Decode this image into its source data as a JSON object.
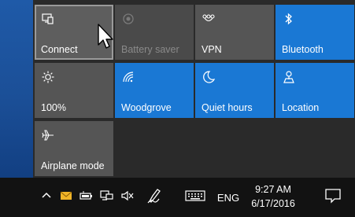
{
  "tiles": [
    {
      "id": "connect",
      "label": "Connect",
      "icon": "cast-icon",
      "state": "hover"
    },
    {
      "id": "battery-saver",
      "label": "Battery saver",
      "icon": "battery-saver-icon",
      "state": "disabled"
    },
    {
      "id": "vpn",
      "label": "VPN",
      "icon": "vpn-icon",
      "state": "off"
    },
    {
      "id": "bluetooth",
      "label": "Bluetooth",
      "icon": "bluetooth-icon",
      "state": "on"
    },
    {
      "id": "brightness",
      "label": "100%",
      "icon": "brightness-icon",
      "state": "off"
    },
    {
      "id": "wifi",
      "label": "Woodgrove",
      "icon": "wifi-icon",
      "state": "on"
    },
    {
      "id": "quiet-hours",
      "label": "Quiet hours",
      "icon": "moon-icon",
      "state": "on"
    },
    {
      "id": "location",
      "label": "Location",
      "icon": "location-icon",
      "state": "on"
    },
    {
      "id": "airplane-mode",
      "label": "Airplane mode",
      "icon": "airplane-icon",
      "state": "off"
    }
  ],
  "taskbar": {
    "language": "ENG",
    "time": "9:27 AM",
    "date": "6/17/2016",
    "icons": [
      "chevron-up-icon",
      "mail-icon",
      "battery-icon",
      "network-icon",
      "volume-muted-icon",
      "pen-icon",
      "keyboard-icon",
      "action-center-icon"
    ]
  },
  "colors": {
    "accent": "#1a78d4",
    "tile_off": "#555555",
    "taskbar": "#121212"
  }
}
